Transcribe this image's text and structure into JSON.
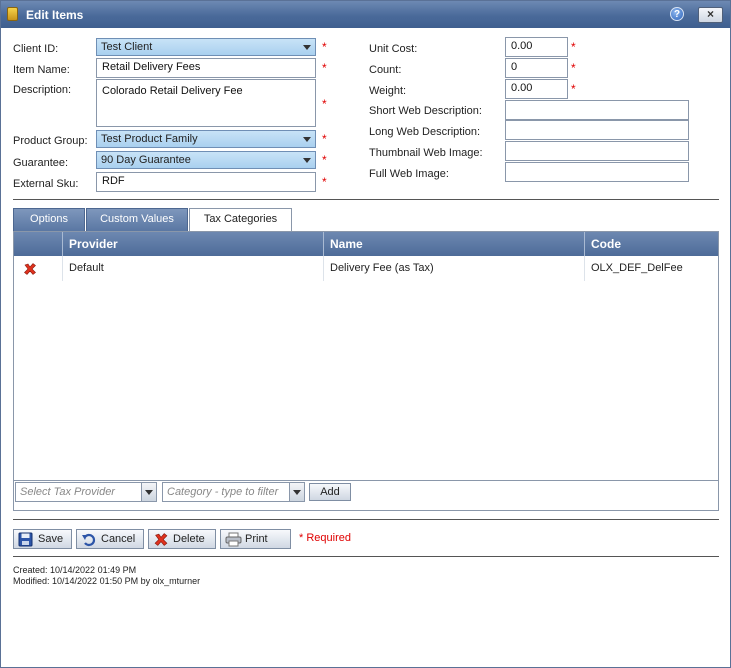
{
  "window": {
    "title": "Edit Items",
    "help_label": "?",
    "close_label": "×"
  },
  "form": {
    "client_id": {
      "label": "Client ID:",
      "value": "Test Client"
    },
    "item_name": {
      "label": "Item Name:",
      "value": "Retail Delivery Fees"
    },
    "description": {
      "label": "Description:",
      "value": "Colorado Retail Delivery Fee"
    },
    "product_group": {
      "label": "Product Group:",
      "value": "Test Product Family"
    },
    "guarantee": {
      "label": "Guarantee:",
      "value": "90 Day Guarantee"
    },
    "external_sku": {
      "label": "External Sku:",
      "value": "RDF"
    },
    "unit_cost": {
      "label": "Unit Cost:",
      "value": "0.00"
    },
    "count": {
      "label": "Count:",
      "value": "0"
    },
    "weight": {
      "label": "Weight:",
      "value": "0.00"
    },
    "short_web_description": {
      "label": "Short Web Description:",
      "value": ""
    },
    "long_web_description": {
      "label": "Long Web Description:",
      "value": ""
    },
    "thumbnail_web_image": {
      "label": "Thumbnail Web Image:",
      "value": ""
    },
    "full_web_image": {
      "label": "Full Web Image:",
      "value": ""
    },
    "required_mark": "*"
  },
  "tabs": [
    {
      "label": "Options"
    },
    {
      "label": "Custom Values"
    },
    {
      "label": "Tax Categories"
    }
  ],
  "grid": {
    "columns": [
      "Provider",
      "Name",
      "Code"
    ],
    "rows": [
      {
        "provider": "Default",
        "name": "Delivery Fee (as Tax)",
        "code": "OLX_DEF_DelFee"
      }
    ]
  },
  "add_bar": {
    "provider_placeholder": "Select Tax Provider",
    "category_placeholder": "Category - type to filter",
    "add_label": "Add"
  },
  "actions": {
    "save": "Save",
    "cancel": "Cancel",
    "delete": "Delete",
    "print": "Print",
    "required_note": "* Required"
  },
  "meta": {
    "created": "Created:  10/14/2022 01:49 PM",
    "modified": "Modified:  10/14/2022 01:50 PM by olx_mturner"
  },
  "colors": {
    "accent": "#4a6a9a",
    "required": "#e00000",
    "combo_fill": "#b8daf3"
  }
}
